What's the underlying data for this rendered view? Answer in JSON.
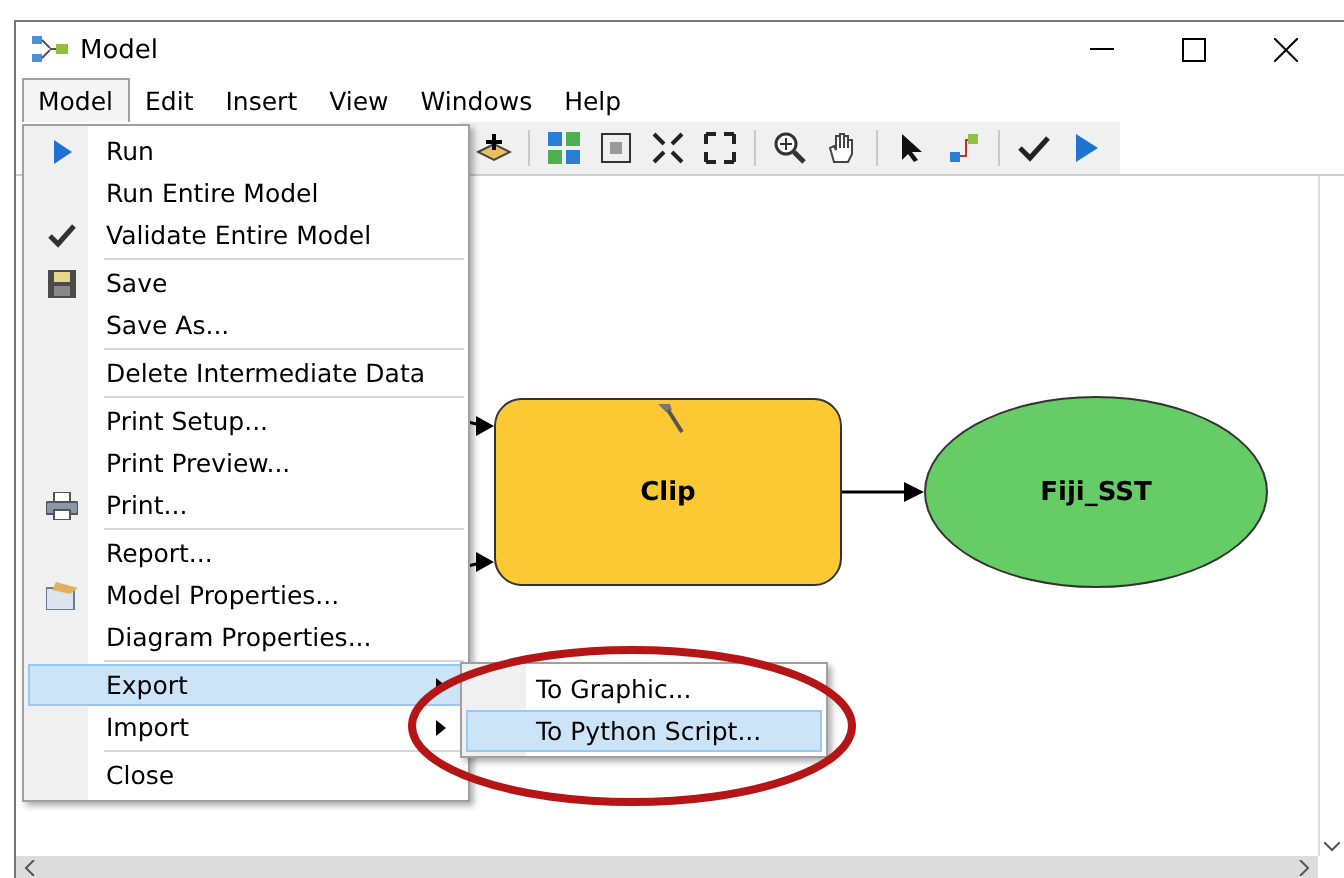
{
  "window": {
    "title": "Model"
  },
  "menu_bar": [
    {
      "label": "Model",
      "selected": true
    },
    {
      "label": "Edit",
      "selected": false
    },
    {
      "label": "Insert",
      "selected": false
    },
    {
      "label": "View",
      "selected": false
    },
    {
      "label": "Windows",
      "selected": false
    },
    {
      "label": "Help",
      "selected": false
    }
  ],
  "model_menu": {
    "groups": [
      [
        {
          "label": "Run",
          "kind": "run",
          "selected": false
        },
        {
          "label": "Run Entire Model",
          "kind": "plain",
          "selected": false
        },
        {
          "label": "Validate Entire Model",
          "kind": "check",
          "selected": false
        }
      ],
      [
        {
          "label": "Save",
          "kind": "save",
          "selected": false
        },
        {
          "label": "Save As...",
          "kind": "plain",
          "selected": false
        }
      ],
      [
        {
          "label": "Delete Intermediate Data",
          "kind": "plain",
          "selected": false
        }
      ],
      [
        {
          "label": "Print Setup...",
          "kind": "plain",
          "selected": false
        },
        {
          "label": "Print Preview...",
          "kind": "plain",
          "selected": false
        },
        {
          "label": "Print...",
          "kind": "print",
          "selected": false
        }
      ],
      [
        {
          "label": "Report...",
          "kind": "plain",
          "selected": false
        },
        {
          "label": "Model Properties...",
          "kind": "properties",
          "selected": false
        },
        {
          "label": "Diagram Properties...",
          "kind": "plain",
          "selected": false
        }
      ],
      [
        {
          "label": "Export",
          "kind": "submenu",
          "selected": true
        },
        {
          "label": "Import",
          "kind": "submenu",
          "selected": false
        }
      ],
      [
        {
          "label": "Close",
          "kind": "plain",
          "selected": false
        }
      ]
    ]
  },
  "export_submenu": [
    {
      "label": "To Graphic...",
      "selected": false
    },
    {
      "label": "To Python Script...",
      "selected": true
    }
  ],
  "diagram": {
    "nodes": [
      {
        "kind": "tool",
        "label": "Clip"
      },
      {
        "kind": "data",
        "label": "Fiji_SST"
      }
    ]
  }
}
